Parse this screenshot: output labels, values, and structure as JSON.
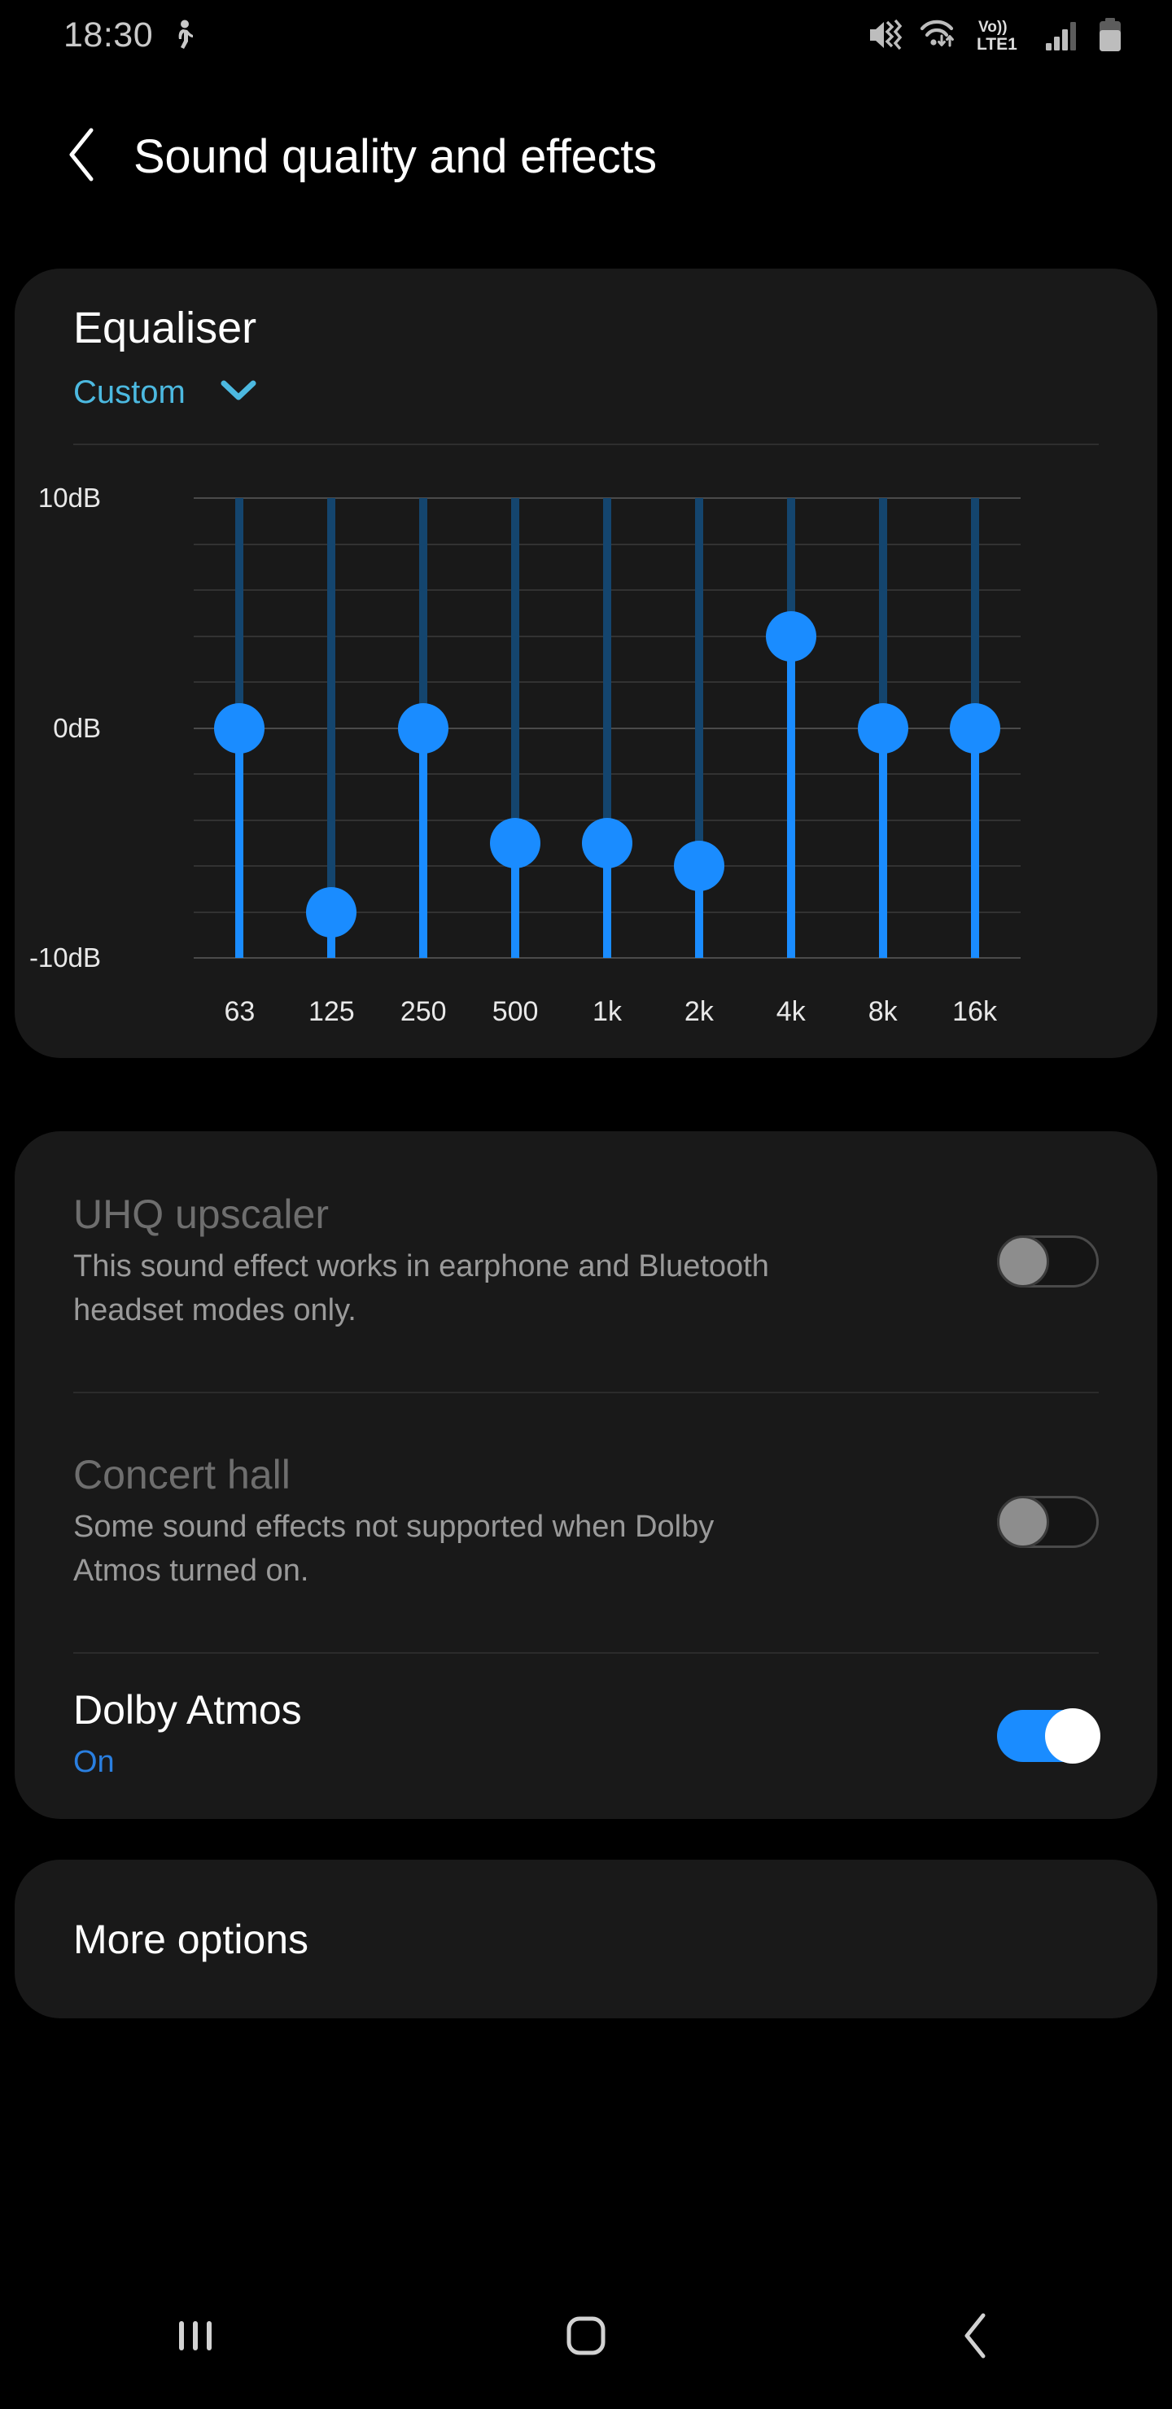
{
  "statusbar": {
    "time": "18:30",
    "left_icons": [
      {
        "name": "pedometer-icon"
      }
    ],
    "right_icons": [
      {
        "name": "mute-vibrate-icon"
      },
      {
        "name": "wifi-data-icon"
      },
      {
        "name": "volte-icon",
        "label_top": "Vo))",
        "label_bottom": "LTE1"
      },
      {
        "name": "signal-bars-icon",
        "bars": 3,
        "total_bars": 4
      },
      {
        "name": "battery-icon",
        "level_percent": 70
      }
    ]
  },
  "header": {
    "back_label": "Back",
    "title": "Sound quality and effects"
  },
  "equaliser": {
    "title": "Equaliser",
    "preset": "Custom",
    "dropdown_icon": "chevron-down-icon",
    "accent_color": "#4cb9e0"
  },
  "chart_data": {
    "type": "bar",
    "title": "Equaliser",
    "xlabel": "",
    "ylabel": "dB",
    "categories": [
      "63",
      "125",
      "250",
      "500",
      "1k",
      "2k",
      "4k",
      "8k",
      "16k"
    ],
    "values": [
      0,
      -8,
      0,
      -5,
      -5,
      -6,
      4,
      0,
      0
    ],
    "ylim": [
      -10,
      10
    ],
    "ytick_labels": [
      "10dB",
      "0dB",
      "-10dB"
    ],
    "ytick_values": [
      10,
      0,
      -10
    ],
    "gridline_step_db": 2,
    "grid": true,
    "legend": "none",
    "series_color": "#1a8cff",
    "track_color": "#14456e"
  },
  "settings": {
    "rows": [
      {
        "name": "uhq-upscaler",
        "title": "UHQ upscaler",
        "subtitle": "This sound effect works in earphone and Bluetooth headset modes only.",
        "state": "off",
        "enabled": false
      },
      {
        "name": "concert-hall",
        "title": "Concert hall",
        "subtitle": "Some sound effects not supported when Dolby Atmos turned on.",
        "state": "off",
        "enabled": false
      },
      {
        "name": "dolby-atmos",
        "title": "Dolby Atmos",
        "subtitle": "On",
        "state": "on",
        "enabled": true
      }
    ]
  },
  "more_options": {
    "label": "More options"
  },
  "navbar": {
    "recents_label": "Recents",
    "home_label": "Home",
    "back_label": "Back"
  },
  "colors": {
    "accent_blue": "#1a8cff",
    "preset_cyan": "#4cb9e0",
    "status_blue": "#2a7fe0",
    "card_bg": "#191919",
    "page_bg": "#000000"
  }
}
